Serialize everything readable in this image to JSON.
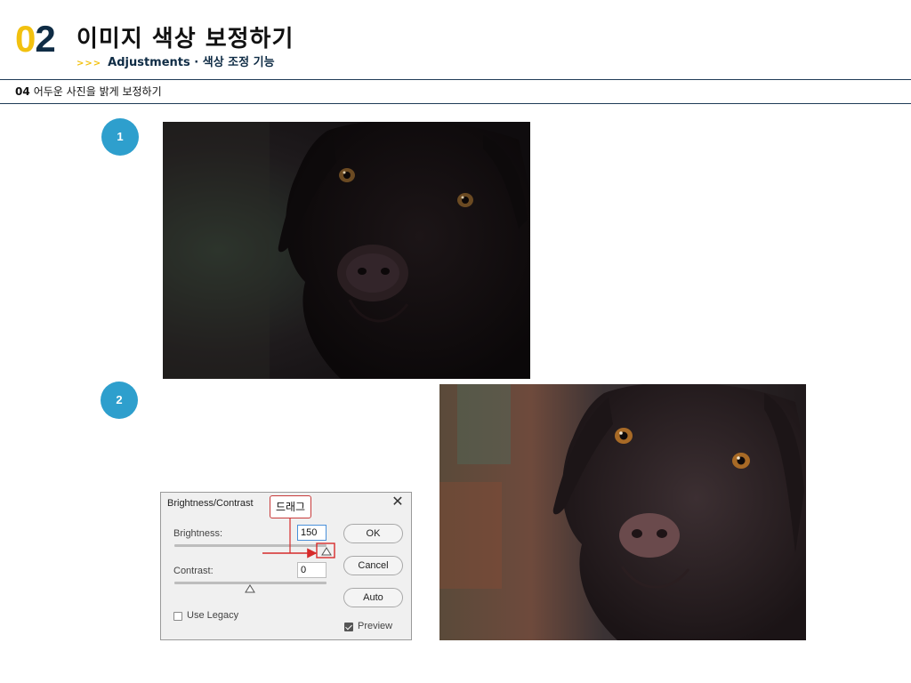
{
  "header": {
    "number_first": "0",
    "number_second": "2",
    "title": "이미지 색상 보정하기",
    "subtitle_chevrons": ">>>",
    "subtitle": "Adjustments · 색상 조정 기능"
  },
  "section": {
    "number": "04",
    "title": "어두운 사진을 밝게 보정하기"
  },
  "steps": [
    {
      "label": "1"
    },
    {
      "label": "2"
    }
  ],
  "dialog": {
    "title": "Brightness/Contrast",
    "close": "✕",
    "brightness_label": "Brightness:",
    "brightness_value": "150",
    "contrast_label": "Contrast:",
    "contrast_value": "0",
    "ok_label": "OK",
    "cancel_label": "Cancel",
    "auto_label": "Auto",
    "use_legacy_label": "Use Legacy",
    "use_legacy_checked": false,
    "preview_label": "Preview",
    "preview_checked": true
  },
  "callout": {
    "text": "드래그"
  },
  "colors": {
    "accent_yellow": "#f2c10f",
    "navy": "#0f2c45",
    "badge_blue": "#2e9fcd",
    "annotation_red": "#d62b2b"
  }
}
